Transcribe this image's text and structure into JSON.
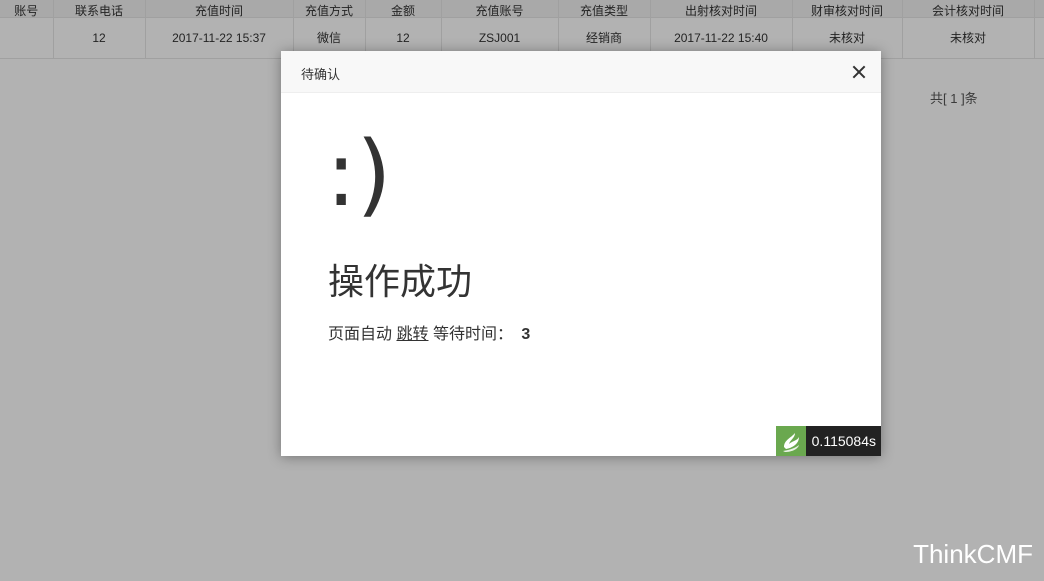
{
  "table": {
    "headers": [
      "账号",
      "联系电话",
      "充值时间",
      "充值方式",
      "金额",
      "充值账号",
      "充值类型",
      "出射核对时间",
      "财审核对时间",
      "会计核对时间",
      ""
    ],
    "rows": [
      [
        "",
        "12",
        "2017-11-22 15:37",
        "微信",
        "12",
        "ZSJ001",
        "经销商",
        "2017-11-22 15:40",
        "未核对",
        "未核对",
        ""
      ]
    ]
  },
  "pager": {
    "total_text": "共[ 1 ]条"
  },
  "dialog": {
    "title": "待确认",
    "emoticon": ":)",
    "message": "操作成功",
    "jump_prefix": "页面自动",
    "jump_link": "跳转",
    "wait_label": "等待时间：",
    "wait_seconds": "3"
  },
  "trace": {
    "runtime": "0.115084s",
    "icon": "thinkphp-trace-icon"
  },
  "branding": {
    "name": "ThinkCMF"
  },
  "colors": {
    "overlay": "rgba(0,0,0,0.3)",
    "trace_bg": "#222222",
    "trace_icon_bg": "#6aa84f"
  }
}
